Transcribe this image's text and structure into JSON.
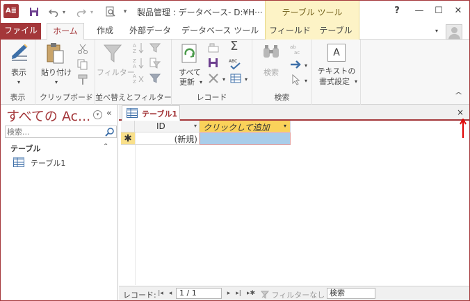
{
  "window": {
    "title": "製品管理 : データベース- D:¥H···",
    "context_tab_header": "テーブル ツール",
    "controls": {
      "help": "?",
      "minimize": "—",
      "restore": "☐",
      "close": "✕"
    }
  },
  "quick_access": {
    "customize": "▾"
  },
  "tabs": {
    "file": "ファイル",
    "home": "ホーム",
    "create": "作成",
    "external": "外部データ",
    "dbtools": "データベース ツール",
    "fields": "フィールド",
    "table": "テーブル"
  },
  "ribbon": {
    "groups": {
      "views": "表示",
      "clipboard": "クリップボード",
      "sort_filter": "並べ替えとフィルター",
      "records": "レコード",
      "find": "検索"
    },
    "buttons": {
      "view": "表示",
      "paste": "貼り付け",
      "filter": "フィルター",
      "refresh_line1": "すべて",
      "refresh_line2": "更新",
      "find": "検索",
      "text_format_line1": "テキストの",
      "text_format_line2": "書式設定",
      "text_format_icon": "A",
      "totals_icon": "Σ",
      "spelling_icon": "ABC"
    },
    "collapse": "^"
  },
  "nav_pane": {
    "title": "すべての Ac...",
    "search_placeholder": "検索...",
    "group_header": "テーブル",
    "items": [
      {
        "label": "テーブル1"
      }
    ],
    "collapse_glyph": "«",
    "group_collapse_glyph": "⌃"
  },
  "document": {
    "tab_label": "テーブル1",
    "close_glyph": "×",
    "columns": [
      {
        "label": "ID"
      },
      {
        "label": "クリックして追加"
      }
    ],
    "new_row": {
      "selector": "✱",
      "id_value": "(新規)"
    }
  },
  "record_nav": {
    "label": "レコード:",
    "position": "1 / 1",
    "filter_state": "フィルターなし",
    "search_value": "検索"
  },
  "colors": {
    "accent": "#a4373a",
    "context_tab": "#fdf3c6",
    "column_highlight": "#fad25a",
    "selected_cell": "#a9cdea"
  }
}
